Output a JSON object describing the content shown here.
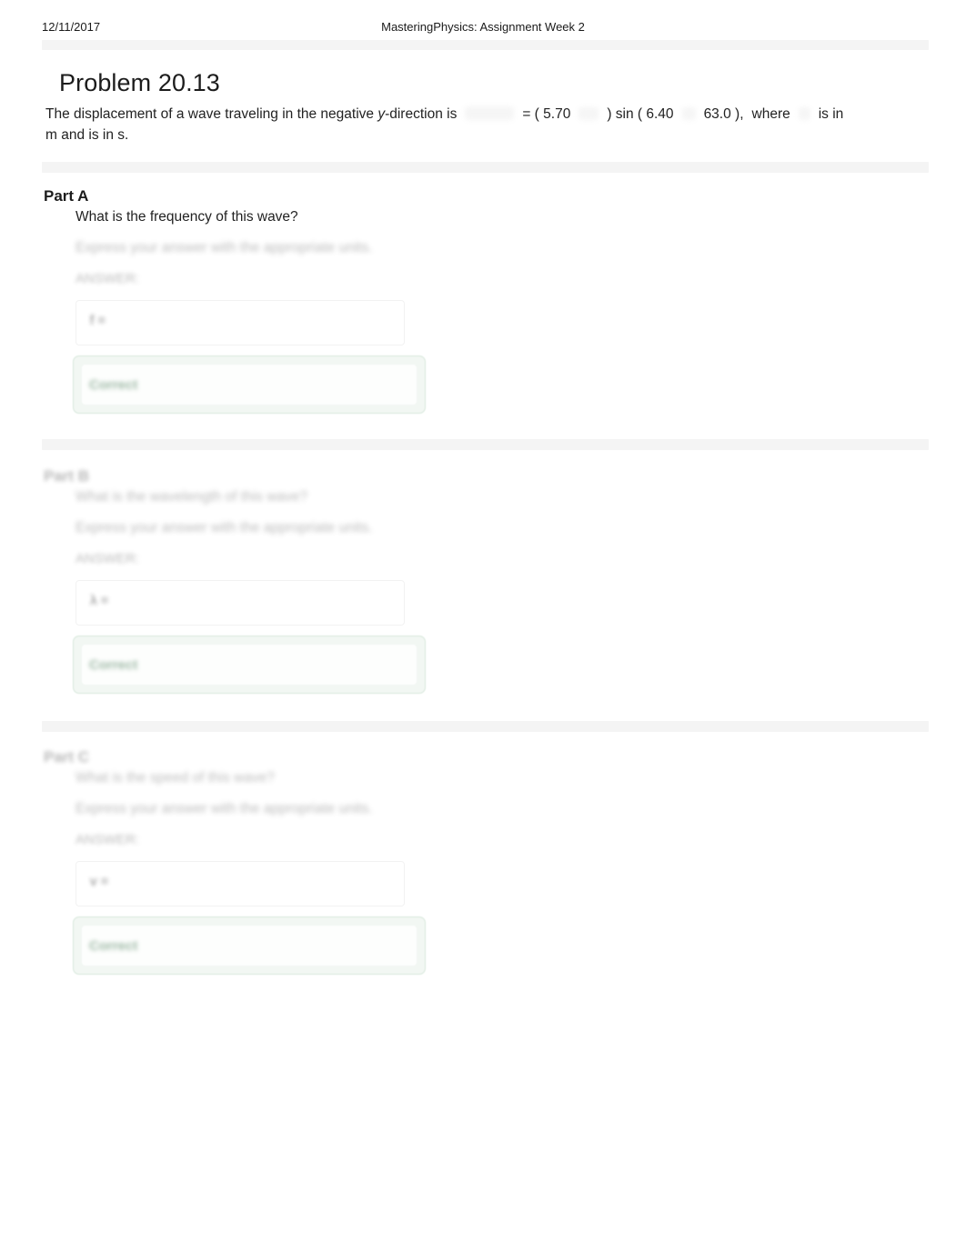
{
  "page": {
    "header": {
      "date": "12/11/2017",
      "title": "MasteringPhysics: Assignment Week 2"
    },
    "problem_title": "Problem 20.13",
    "statement": {
      "line1_a": "The displacement of a wave traveling in the negative ",
      "line1_y": "y",
      "line1_b": "-direction is",
      "eq_open": "= ( 5.70",
      "eq_close": ") sin ( 6.40",
      "eq_const": "63.0 ),",
      "eq_where": "where",
      "eq_isin": "is in",
      "line2": "m and is in s.",
      "math_placeholders": [
        "displacement-function-image",
        "cm-unit-image",
        "x-variable-image",
        "t-variable-image",
        "x-variable-image-2"
      ]
    },
    "parts": [
      {
        "heading": "Part A",
        "heading_faded": false,
        "question": "What is the frequency of this wave?",
        "question_faded": false,
        "express": "Express your answer with the appropriate units.",
        "hint": "ANSWER:",
        "answer_label": "f =",
        "answer_value": "",
        "feedback_label": "Correct",
        "feedback_color": "#4a7c59",
        "feedback_bg": "#f2f7f3"
      },
      {
        "heading": "Part B",
        "heading_faded": true,
        "question": "What is the wavelength of this wave?",
        "question_faded": true,
        "express": "Express your answer with the appropriate units.",
        "hint": "ANSWER:",
        "answer_label": "λ =",
        "answer_value": "",
        "feedback_label": "Correct",
        "feedback_color": "#4a7c59",
        "feedback_bg": "#f2f7f3"
      },
      {
        "heading": "Part C",
        "heading_faded": true,
        "question": "What is the speed of this wave?",
        "question_faded": true,
        "express": "Express your answer with the appropriate units.",
        "hint": "ANSWER:",
        "answer_label": "v =",
        "answer_value": "",
        "feedback_label": "Correct",
        "feedback_color": "#4a7c59",
        "feedback_bg": "#f2f7f3"
      }
    ],
    "colors": {
      "page_background": "#ffffff",
      "band": "#f4f4f4",
      "text": "#222222",
      "feedback_border": "#d8e8dc"
    }
  }
}
